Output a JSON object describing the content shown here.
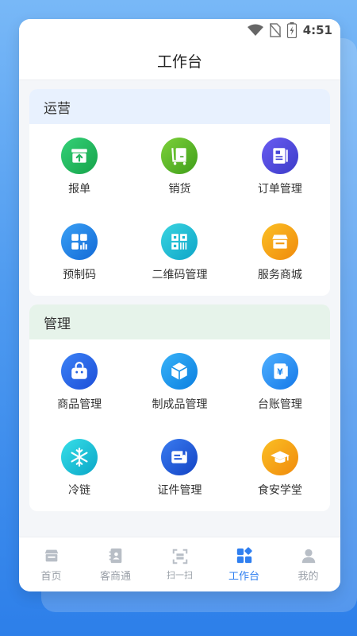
{
  "status_bar": {
    "time": "4:51"
  },
  "header": {
    "title": "工作台"
  },
  "sections": [
    {
      "title": "运营",
      "items": [
        {
          "label": "报单",
          "icon": "upload-box-icon",
          "color": "#22c55e"
        },
        {
          "label": "销货",
          "icon": "cart-icon",
          "color": "#55b82b"
        },
        {
          "label": "订单管理",
          "icon": "order-list-icon",
          "color": "#4f46e5"
        },
        {
          "label": "预制码",
          "icon": "grid-chart-icon",
          "color": "#1e88e5"
        },
        {
          "label": "二维码管理",
          "icon": "qrcode-icon",
          "color": "#14b8d0"
        },
        {
          "label": "服务商城",
          "icon": "shop-icon",
          "color": "#f59e0b"
        }
      ]
    },
    {
      "title": "管理",
      "items": [
        {
          "label": "商品管理",
          "icon": "bag-icon",
          "color": "#2563eb"
        },
        {
          "label": "制成品管理",
          "icon": "cube-icon",
          "color": "#1d9bf0"
        },
        {
          "label": "台账管理",
          "icon": "ledger-icon",
          "color": "#1e90ff"
        },
        {
          "label": "冷链",
          "icon": "snowflake-icon",
          "color": "#0ec5d6"
        },
        {
          "label": "证件管理",
          "icon": "certificate-icon",
          "color": "#1d5fe0"
        },
        {
          "label": "食安学堂",
          "icon": "graduation-cap-icon",
          "color": "#f59e0b"
        }
      ]
    }
  ],
  "tabbar": [
    {
      "label": "首页",
      "icon": "store-icon",
      "active": false
    },
    {
      "label": "客商通",
      "icon": "contacts-icon",
      "active": false
    },
    {
      "label": "扫一扫",
      "icon": "scan-icon",
      "active": false
    },
    {
      "label": "工作台",
      "icon": "workbench-icon",
      "active": true
    },
    {
      "label": "我的",
      "icon": "user-icon",
      "active": false
    }
  ],
  "colors": {
    "accent": "#2f7ff0",
    "inactive": "#9aa0a8"
  }
}
